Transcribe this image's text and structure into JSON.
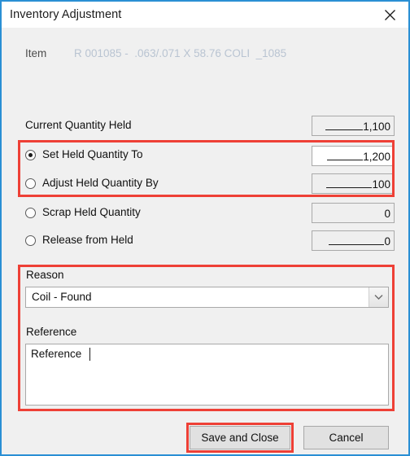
{
  "window": {
    "title": "Inventory Adjustment",
    "close_icon": "close-icon",
    "accent_border": "#2a8fd4"
  },
  "item": {
    "label": "Item",
    "value": "R 001085 -  .063/.071 X 58.76 COLI  _1085"
  },
  "rows": [
    {
      "label": "Current Quantity Held",
      "value": "1,100",
      "mask": "______",
      "radio": null,
      "field_bg": "grey",
      "underline": true
    },
    {
      "label": "Set Held Quantity To",
      "value": "1,200",
      "mask": "______",
      "radio": true,
      "field_bg": "white",
      "underline": true
    },
    {
      "label": "Adjust Held Quantity By",
      "value": "100",
      "mask": "________",
      "radio": false,
      "field_bg": "grey",
      "underline": true
    },
    {
      "label": "Scrap Held Quantity",
      "value": "0",
      "mask": "",
      "radio": false,
      "field_bg": "grey",
      "underline": false
    },
    {
      "label": "Release from Held",
      "value": "0",
      "mask": "_________",
      "radio": false,
      "field_bg": "grey",
      "underline": true
    }
  ],
  "reason": {
    "label": "Reason",
    "selected": "Coil - Found",
    "arrow_icon": "chevron-down-icon"
  },
  "reference": {
    "label": "Reference",
    "value": "Reference "
  },
  "buttons": {
    "save": "Save and Close",
    "cancel": "Cancel"
  },
  "annotations": {
    "color": "#ee4036",
    "targets": [
      "quantity-options",
      "reason-reference-group",
      "save-and-close-button"
    ]
  }
}
